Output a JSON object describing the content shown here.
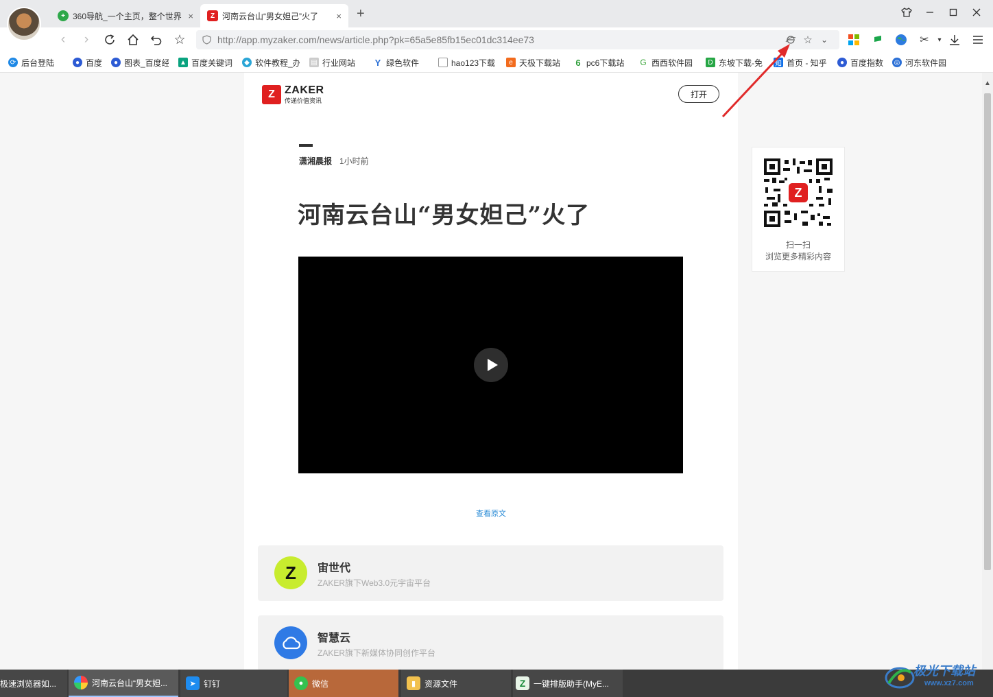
{
  "browser": {
    "tabs": [
      {
        "label": "360导航_一个主页，整个世界",
        "close": "×"
      },
      {
        "label": "河南云台山“男女妲己”火了",
        "close": "×"
      }
    ],
    "new_tab": "+",
    "url": "http://app.myzaker.com/news/article.php?pk=65a5e85fb15ec01dc314ee73",
    "bookmarks": [
      {
        "label": "后台登陆",
        "color": "#1e88e5"
      },
      {
        "label": "百度",
        "color": "#2d5bd4"
      },
      {
        "label": "图表_百度经",
        "color": "#2d5bd4"
      },
      {
        "label": "百度关键词",
        "color": "#0aa37f"
      },
      {
        "label": "软件教程_办",
        "color": "#2aa5d6"
      },
      {
        "label": "行业网站",
        "color": "#8a8a8a"
      },
      {
        "label": "绿色软件",
        "color": "#2a6fd6"
      },
      {
        "label": "hao123下载",
        "color": "#999999"
      },
      {
        "label": "天极下载站",
        "color": "#f26b1d"
      },
      {
        "label": "pc6下载站",
        "color": "#2e9e3a"
      },
      {
        "label": "西西软件园",
        "color": "#3aa63a"
      },
      {
        "label": "东坡下载-免",
        "color": "#26a645"
      },
      {
        "label": "首页 - 知乎",
        "color": "#0f6fe8"
      },
      {
        "label": "百度指数",
        "color": "#2d5bd4"
      },
      {
        "label": "河东软件园",
        "color": "#2a6fd6"
      }
    ]
  },
  "article": {
    "brand": "ZAKER",
    "brand_icon": "Z",
    "slogan": "传递价值资讯",
    "open_button": "打开",
    "source": "潇湘晨报",
    "time": "1小时前",
    "title": "河南云台山“男女妲己”火了",
    "view_original": "查看原文",
    "promos": [
      {
        "title": "宙世代",
        "subtitle": "ZAKER旗下Web3.0元宇宙平台",
        "icon": "Z"
      },
      {
        "title": "智慧云",
        "subtitle": "ZAKER旗下新媒体协同创作平台",
        "icon": "cloud"
      }
    ]
  },
  "qr": {
    "line1": "扫一扫",
    "line2": "浏览更多精彩内容",
    "center_icon": "Z"
  },
  "taskbar": {
    "items": [
      {
        "label": "极速浏览器如..."
      },
      {
        "label": "河南云台山“男女妲..."
      },
      {
        "label": "钉钉"
      },
      {
        "label": "微信"
      },
      {
        "label": "资源文件"
      },
      {
        "label": "一键排版助手(MyE..."
      }
    ]
  },
  "watermark": {
    "text": "极光下载站",
    "url": "www.xz7.com"
  },
  "colors": {
    "accent_red": "#e02020",
    "link_blue": "#2a8bd6",
    "wechat_active": "#b8683a"
  }
}
